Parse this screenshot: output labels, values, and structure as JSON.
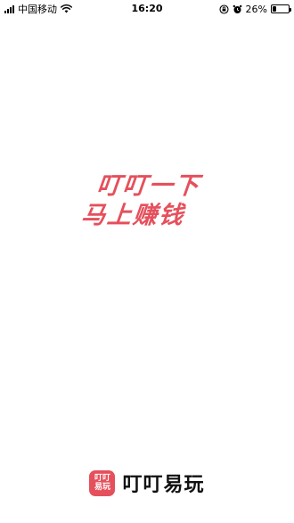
{
  "status_bar": {
    "carrier": "中国移动",
    "time": "16:20",
    "battery_percent": "26%",
    "battery_level": 0.26,
    "icons": [
      "signal-icon",
      "wifi-icon",
      "orientation-lock-icon",
      "alarm-icon",
      "battery-icon"
    ]
  },
  "splash": {
    "slogan_line1": "叮叮一下",
    "slogan_line2": "马上赚钱",
    "accent_color": "#e5505c"
  },
  "brand": {
    "logo_line1": "叮叮",
    "logo_line2": "易玩",
    "name": "叮叮易玩"
  }
}
